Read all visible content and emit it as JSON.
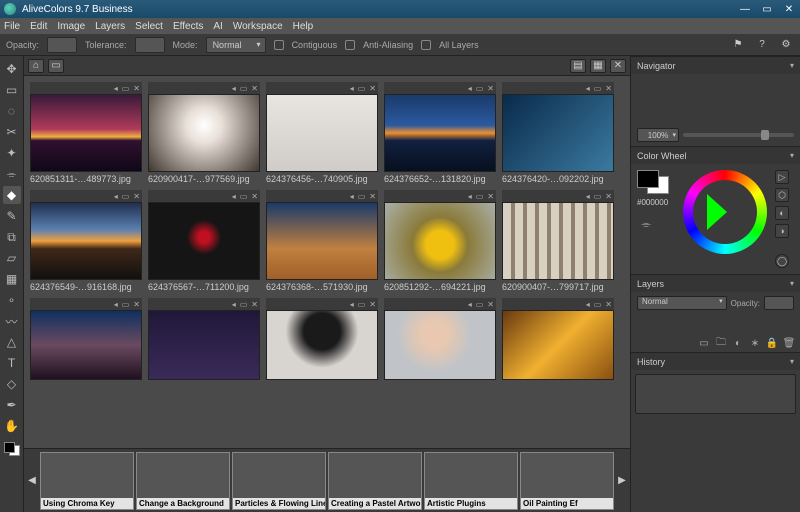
{
  "title": "AliveColors 9.7 Business",
  "menu": [
    "File",
    "Edit",
    "Image",
    "Layers",
    "Select",
    "Effects",
    "AI",
    "Workspace",
    "Help"
  ],
  "options": {
    "opacity_lbl": "Opacity:",
    "tolerance_lbl": "Tolerance:",
    "mode_lbl": "Mode:",
    "mode_val": "Normal",
    "contiguous_lbl": "Contiguous",
    "antialias_lbl": "Anti-Aliasing",
    "alllayers_lbl": "All Layers"
  },
  "thumbs": [
    [
      {
        "name": "620851311-…489773.jpg",
        "cls": "g-sunset1"
      },
      {
        "name": "620900417-…977569.jpg",
        "cls": "g-ballerina"
      },
      {
        "name": "624376456-…740905.jpg",
        "cls": "g-hat1"
      },
      {
        "name": "624376652-…131820.jpg",
        "cls": "g-lakesunset"
      },
      {
        "name": "624376420-…092202.jpg",
        "cls": "g-bluewoman"
      }
    ],
    [
      {
        "name": "624376549-…916168.jpg",
        "cls": "g-mtnsunset"
      },
      {
        "name": "624376567-…711200.jpg",
        "cls": "g-roselady"
      },
      {
        "name": "624376368-…571930.jpg",
        "cls": "g-stork"
      },
      {
        "name": "620851292-…694221.jpg",
        "cls": "g-sunflower"
      },
      {
        "name": "620900407-…799717.jpg",
        "cls": "g-columns"
      }
    ],
    [
      {
        "name": "",
        "cls": "g-dusk"
      },
      {
        "name": "",
        "cls": "g-lightning"
      },
      {
        "name": "",
        "cls": "g-hat2"
      },
      {
        "name": "",
        "cls": "g-portrait"
      },
      {
        "name": "",
        "cls": "g-goldlady"
      }
    ]
  ],
  "tutorials": [
    {
      "label": "Using Chroma Key",
      "cls": "g-chroma"
    },
    {
      "label": "Change a Background",
      "cls": "g-bgchange"
    },
    {
      "label": "Particles & Flowing Lines",
      "cls": "g-particles"
    },
    {
      "label": "Creating a Pastel Artwork",
      "cls": "g-pastel"
    },
    {
      "label": "Artistic Plugins",
      "cls": "g-plugins"
    },
    {
      "label": "Oil Painting Ef",
      "cls": "g-oil"
    }
  ],
  "panels": {
    "navigator": "Navigator",
    "zoom": "100%",
    "colorwheel": "Color Wheel",
    "hex": "#000000",
    "layers": "Layers",
    "layers_blend": "Normal",
    "layers_opacity_lbl": "Opacity:",
    "history": "History"
  }
}
